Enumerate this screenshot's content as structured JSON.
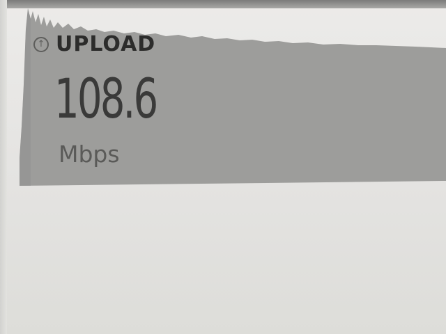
{
  "upload": {
    "label": "UPLOAD",
    "value": "108.6",
    "unit": "Mbps",
    "icon": "arrow-up-circle-icon"
  },
  "colors": {
    "graph_fill": "#9d9d9b",
    "text_dark": "#2c2c2b",
    "background": "#e8e8e6"
  }
}
